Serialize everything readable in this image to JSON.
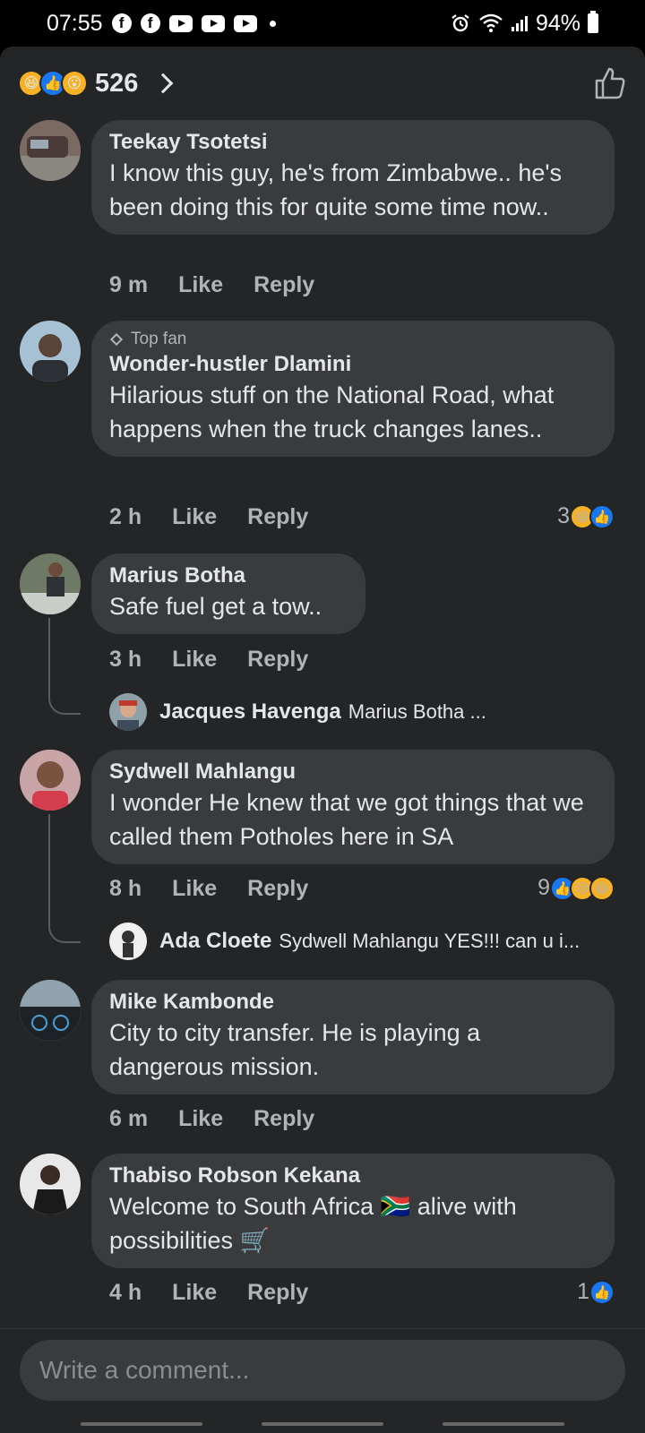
{
  "status_bar": {
    "time": "07:55",
    "notification_icons": [
      "facebook-icon",
      "facebook-icon",
      "youtube-icon",
      "youtube-icon",
      "youtube-icon"
    ],
    "battery": "94%"
  },
  "header": {
    "reactions": [
      "haha",
      "like",
      "wow"
    ],
    "reaction_count": "526"
  },
  "comments": [
    {
      "author": "Teekay Tsotetsi",
      "text": "I know this guy, he's from Zimbabwe.. he's been doing this for quite some time now..",
      "time": "9 m",
      "like_label": "Like",
      "reply_label": "Reply"
    },
    {
      "badge": "Top fan",
      "author": "Wonder-hustler Dlamini",
      "text": "Hilarious stuff on the National Road, what happens when the truck changes lanes..",
      "time": "2 h",
      "like_label": "Like",
      "reply_label": "Reply",
      "reaction_count": "3",
      "reactions": [
        "haha",
        "like"
      ]
    },
    {
      "author": "Marius Botha",
      "text": "Safe fuel get a tow..",
      "time": "3 h",
      "like_label": "Like",
      "reply_label": "Reply",
      "reply": {
        "author": "Jacques Havenga",
        "snippet": "Marius Botha ..."
      }
    },
    {
      "author": "Sydwell Mahlangu",
      "text": "I wonder He knew that we got things that we called them Potholes here in SA",
      "time": "8 h",
      "like_label": "Like",
      "reply_label": "Reply",
      "reaction_count": "9",
      "reactions": [
        "like",
        "sad",
        "haha"
      ],
      "reply": {
        "author": "Ada Cloete",
        "snippet": "Sydwell Mahlangu YES!!!  can u i..."
      }
    },
    {
      "author": "Mike Kambonde",
      "text": "City to city transfer. He is playing a dangerous mission.",
      "time": "6 m",
      "like_label": "Like",
      "reply_label": "Reply"
    },
    {
      "author": "Thabiso Robson Kekana",
      "text": "Welcome to South Africa 🇿🇦 alive with possibilities 🛒",
      "time": "4 h",
      "like_label": "Like",
      "reply_label": "Reply",
      "reaction_count": "1",
      "reactions": [
        "like"
      ]
    }
  ],
  "composer": {
    "placeholder": "Write a comment..."
  },
  "colors": {
    "background": "#242526",
    "bubble": "#3a3b3c",
    "accent": "#1877f2"
  }
}
